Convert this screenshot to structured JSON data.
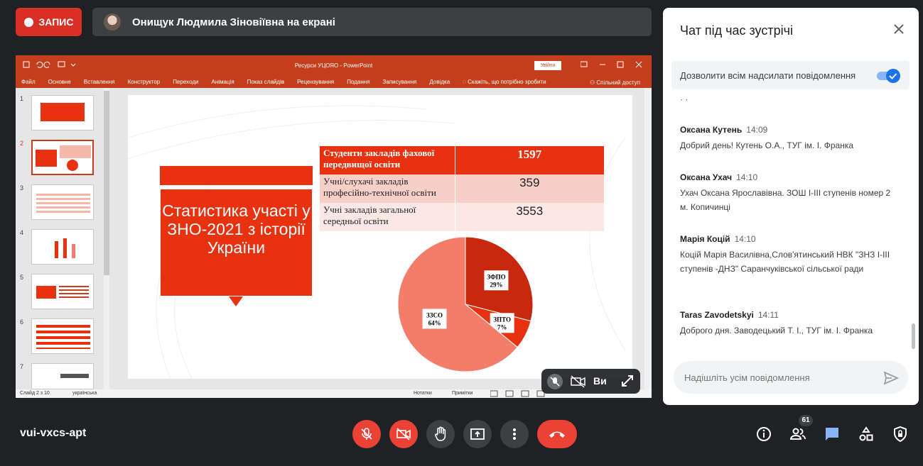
{
  "top": {
    "record_label": "ЗАПИС",
    "presenter_text": "Онищук Людмила Зіновіївна на екрані"
  },
  "powerpoint": {
    "window_title": "Ресурси УЦОЯО  -  PowerPoint",
    "login_button": "Увійти",
    "share_label": "Спільний доступ",
    "ribbon_tabs": [
      "Файл",
      "Основне",
      "Вставлення",
      "Конструктор",
      "Переходи",
      "Анімація",
      "Показ слайдів",
      "Рецензування",
      "Подання",
      "Записування",
      "Довідка"
    ],
    "tell_me": "Скажіть, що потрібно зробити",
    "thumbnail_numbers": [
      "1",
      "2",
      "3",
      "4",
      "5",
      "6",
      "7"
    ],
    "status_slide": "Слайд 2 з 10",
    "status_lang": "українська",
    "notes_label": "Нотатки",
    "comments_label": "Примітки"
  },
  "slide": {
    "title": "Статистика участі у ЗНО-2021 з історії України",
    "table": [
      {
        "label": "Студенти закладів фахової передвищої освіти",
        "value": "1597"
      },
      {
        "label": "Учні/слухачі закладів професійно-технічної освіти",
        "value": "359"
      },
      {
        "label": "Учні закладів загальної середньої освіти",
        "value": "3553"
      }
    ]
  },
  "chart_data": {
    "type": "pie",
    "categories": [
      "ЗФПО",
      "ЗПТО",
      "ЗЗСО"
    ],
    "values": [
      29,
      7,
      64
    ],
    "labels": [
      "ЗФПО 29%",
      "ЗПТО 7%",
      "ЗЗСО 64%"
    ],
    "colors": [
      "#c8290c",
      "#e8320f",
      "#f47c6a"
    ]
  },
  "chart_labels": {
    "zfpo_name": "ЗФПО",
    "zfpo_pct": "29%",
    "zpto_name": "ЗПТО",
    "zpto_pct": "7%",
    "zzso_name": "ЗЗСО",
    "zzso_pct": "64%"
  },
  "mini_controls": {
    "user_short": "Ви"
  },
  "chat": {
    "title": "Чат під час зустрічі",
    "allow_label": "Дозволити всім надсилати повідомлення",
    "allow_enabled": true,
    "messages": [
      {
        "name": "Оксана Кутень",
        "time": "14:09",
        "text": "Добрий день! Кутень О.А., ТУГ ім. І. Франка"
      },
      {
        "name": "Оксана Ухач",
        "time": "14:10",
        "text": "Ухач Оксана Ярославівна. ЗОШ І-ІІІ ступенів номер 2 м. Копичинці"
      },
      {
        "name": "Марія Коцій",
        "time": "14:10",
        "text": "Коцій Марія Василівна,Слов'ятинський НВК \"ЗНЗ І-ІІІ ступенів -ДНЗ\" Саранчуківської сільської ради"
      },
      {
        "name": "Taras Zavodetskyi",
        "time": "14:11",
        "text": "Доброго дня. Заводецький Т. І., ТУГ ім. І. Франка"
      }
    ],
    "input_placeholder": "Надішліть усім повідомлення"
  },
  "bottom": {
    "meeting_code": "vui-vxcs-apt",
    "participants_count": "61"
  }
}
